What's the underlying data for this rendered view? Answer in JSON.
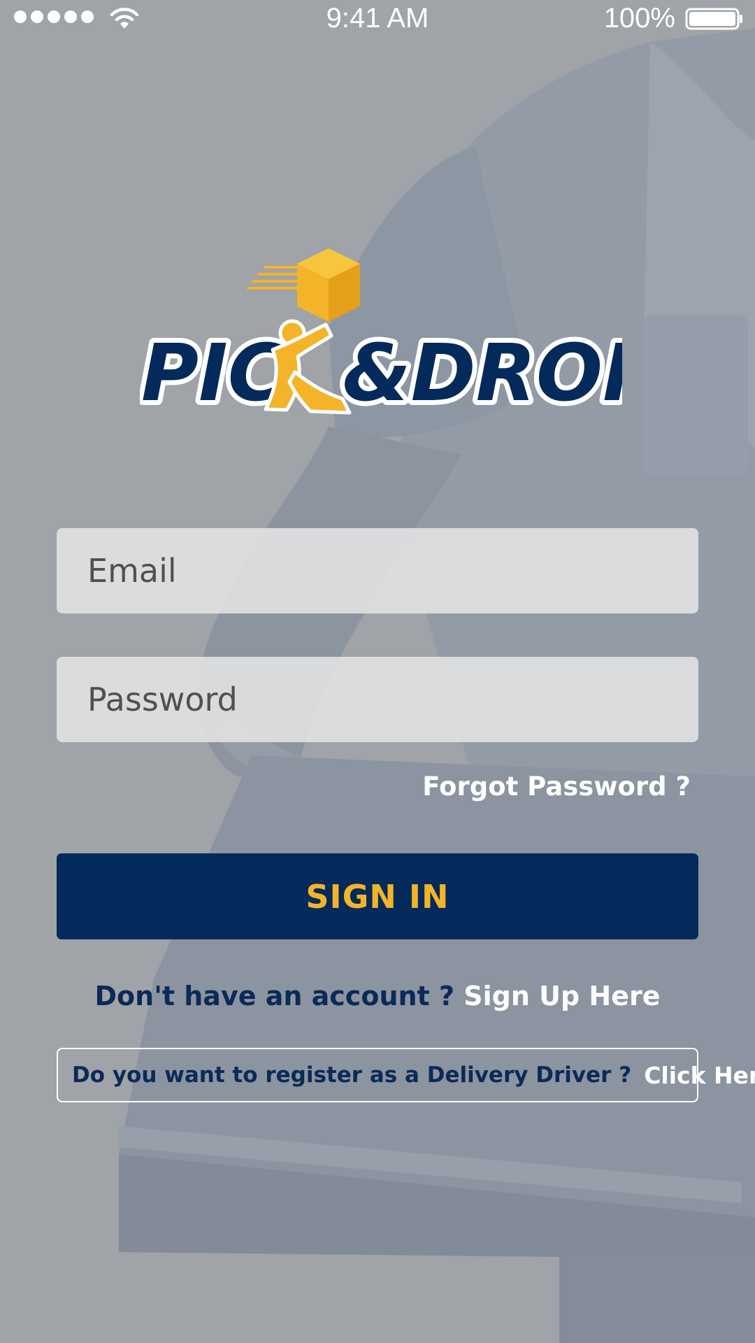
{
  "status_bar": {
    "time": "9:41 AM",
    "battery_percent": "100%",
    "signal_icon": "signal-dots-icon",
    "wifi_icon": "wifi-icon",
    "battery_icon": "battery-icon"
  },
  "logo": {
    "text_left": "PIC",
    "text_right": "&DROP",
    "brand_navy": "#032a5a",
    "brand_yellow": "#f3b42a"
  },
  "login_form": {
    "email_placeholder": "Email",
    "password_placeholder": "Password",
    "forgot_password_label": "Forgot Password ?",
    "sign_in_label": "SIGN IN",
    "no_account_text": "Don't have an account ?",
    "sign_up_label": "Sign Up Here"
  },
  "driver_register": {
    "question": "Do you want to register as a Delivery Driver ?",
    "link_label": "Click Here",
    "icon": "double-chevron-right-icon"
  },
  "colors": {
    "overlay_gray": "#9c9fa3",
    "button_navy": "#032a5a",
    "accent_yellow": "#f3b42a",
    "text_navy": "#0b2a57"
  }
}
